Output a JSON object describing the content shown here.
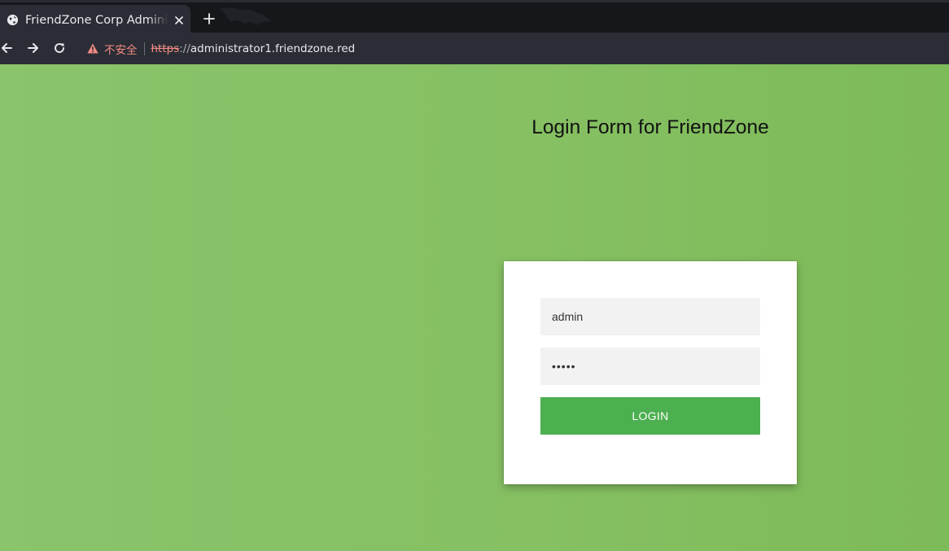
{
  "browser": {
    "tab": {
      "title": "FriendZone Corp Administrator",
      "favicon": "globe-icon",
      "close_icon": "close-icon"
    },
    "new_tab_icon": "plus-icon",
    "toolbar": {
      "back_icon": "arrow-left-icon",
      "forward_icon": "arrow-right-icon",
      "reload_icon": "reload-icon",
      "security_icon": "warning-triangle-icon",
      "security_label": "不安全",
      "url_scheme": "https",
      "url_separator": "://",
      "url_host": "administrator1.friendzone.red"
    },
    "colors": {
      "tabstrip": "#16171b",
      "toolbar": "#2b2d36",
      "warning": "#f28b82"
    }
  },
  "page": {
    "heading": "Login Form for FriendZone",
    "form": {
      "username_value": "admin",
      "password_value": "•••••",
      "login_label": "LOGIN"
    },
    "colors": {
      "background": "#86c063",
      "card": "#ffffff",
      "input": "#f2f2f2",
      "button": "#4caf50"
    }
  }
}
